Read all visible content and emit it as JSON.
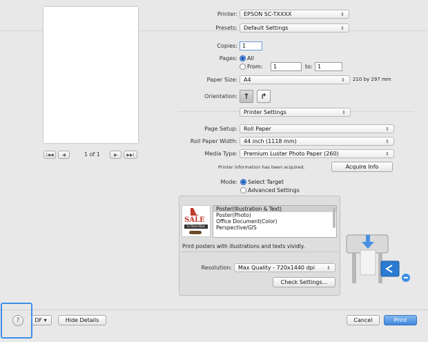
{
  "preview": {
    "nav_first": "|◀◀",
    "nav_prev": "◀",
    "page_indicator": "1 of 1",
    "nav_next": "▶",
    "nav_last": "▶▶|"
  },
  "printer": {
    "label": "Printer:",
    "value": "EPSON SC-TXXXX"
  },
  "presets": {
    "label": "Presets:",
    "value": "Default Settings"
  },
  "copies": {
    "label": "Copies:",
    "value": "1"
  },
  "pages": {
    "label": "Pages:",
    "all_label": "All",
    "from_label": "From:",
    "from_value": "1",
    "to_label": "to:",
    "to_value": "1"
  },
  "paper_size": {
    "label": "Paper Size:",
    "value": "A4",
    "dims": "210 by 297 mm"
  },
  "orientation": {
    "label": "Orientation:",
    "portrait_glyph": "↑",
    "landscape_glyph": "↱"
  },
  "section_popup": {
    "value": "Printer Settings"
  },
  "page_setup": {
    "label": "Page Setup:",
    "value": "Roll Paper"
  },
  "roll_width": {
    "label": "Roll Paper Width:",
    "value": "44 inch (1118 mm)"
  },
  "media_type": {
    "label": "Media Type:",
    "value": "Premium Luster Photo Paper (260)"
  },
  "printer_info": {
    "text": "Printer information has been acquired.",
    "button": "Acquire Info"
  },
  "mode": {
    "label": "Mode:",
    "select_target": "Select Target",
    "advanced": "Advanced Settings"
  },
  "targets": {
    "items": [
      "Poster(Illustration & Text)",
      "Poster(Photo)",
      "Office Document(Color)",
      "Perspective/GIS"
    ],
    "description": "Print posters with illustrations and texts vividly.",
    "thumb_sale": "SALE",
    "thumb_instore": "In Store Now"
  },
  "resolution": {
    "label": "Resolution:",
    "value": "Max Quality - 720x1440 dpi"
  },
  "check_settings": "Check Settings...",
  "bottom": {
    "help": "?",
    "pdf_label": "DF ▾",
    "hide_details": "Hide Details",
    "cancel": "Cancel",
    "print": "Print"
  },
  "accent_color": "#3d8ee6"
}
